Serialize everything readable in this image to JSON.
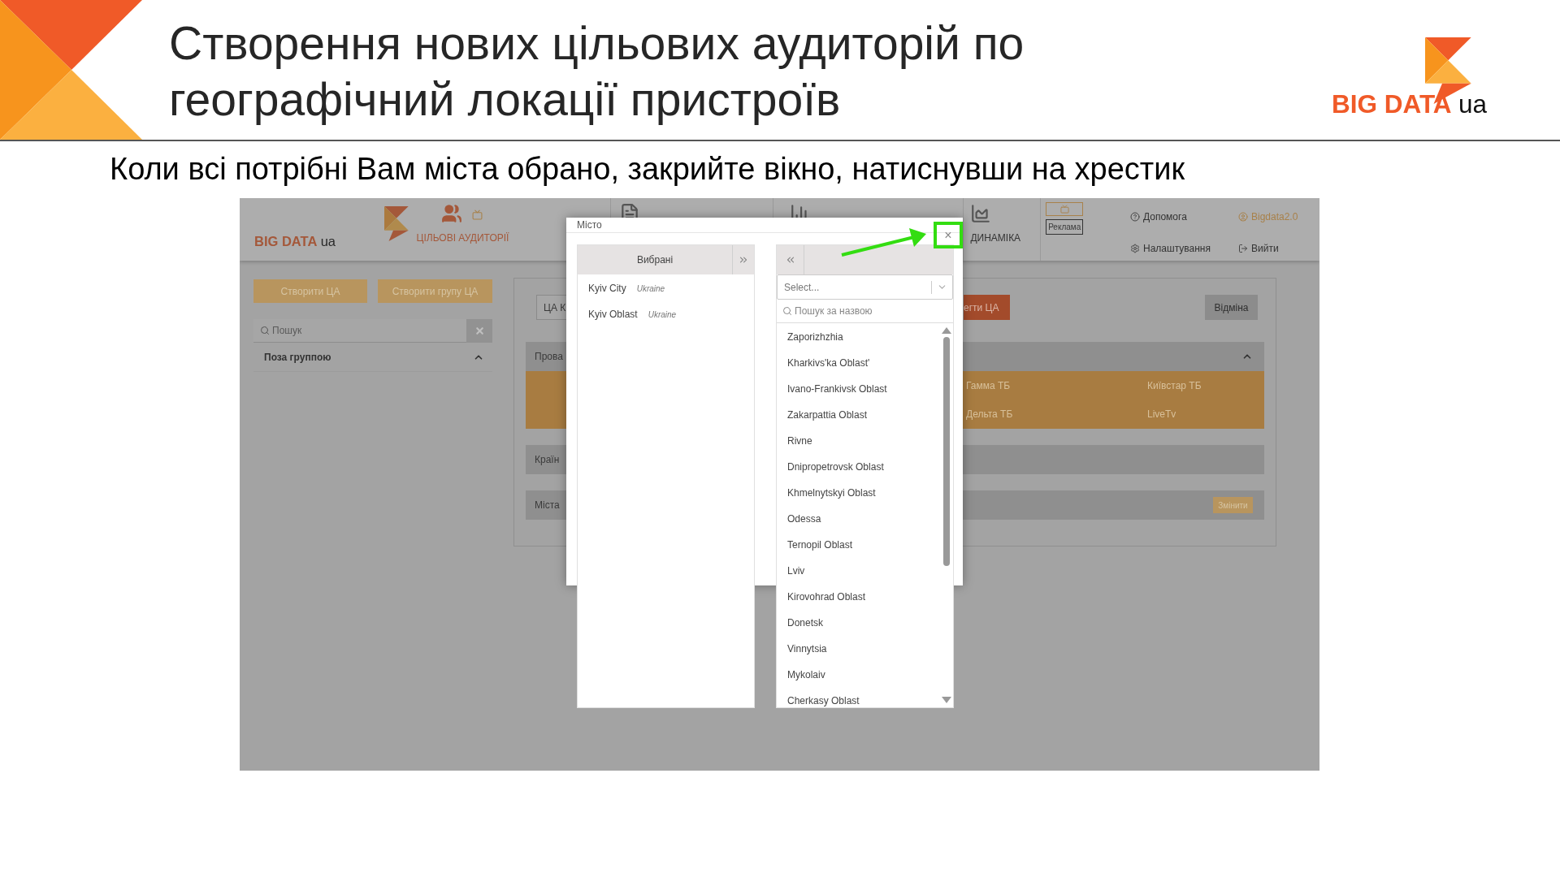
{
  "slide": {
    "title_lines": [
      "Створення нових цільових аудиторій по",
      "географічний локації пристроїв"
    ],
    "logo": {
      "text": "BIG DATA",
      "suffix": "ua"
    },
    "instruction": "Коли всі потрібні Вам міста обрано, закрийте вікно, натиснувши на хрестик"
  },
  "app": {
    "logo": {
      "text": "BIG DATA",
      "suffix": "ua"
    },
    "nav": [
      {
        "kind": "audiences",
        "label": "ЦІЛЬОВІ АУДИТОРІЇ"
      },
      {
        "kind": "documents"
      },
      {
        "kind": "reports"
      },
      {
        "kind": "dynamics",
        "label": "ДИНАМІКА"
      }
    ],
    "ad_badge": "Реклама",
    "links": [
      {
        "kind": "help",
        "label": "Допомога"
      },
      {
        "kind": "user",
        "label": "Bigdata2.0"
      },
      {
        "kind": "settings",
        "label": "Налаштування"
      },
      {
        "kind": "logout",
        "label": "Вийти"
      }
    ],
    "sidebar": {
      "buttons": [
        "Створити ЦА",
        "Створити групу ЦА"
      ],
      "search_placeholder": "Пошук",
      "group": {
        "label": "Поза группою",
        "expanded": true
      }
    },
    "editor": {
      "name_value": "ЦА К",
      "save_button": "егти ЦА",
      "cancel_button": "Відміна",
      "sections": [
        {
          "label": "Прова",
          "expanded": true,
          "items": [
            "Гамма ТБ",
            "Київстар ТБ",
            "Дельта ТБ",
            "LiveTv"
          ]
        },
        {
          "label": "Країн"
        },
        {
          "label": "Міста",
          "action": "Змінити"
        }
      ]
    }
  },
  "modal": {
    "title": "Місто",
    "close": "×",
    "selected_header": "Вибрані",
    "selected": [
      {
        "name": "Kyiv City",
        "country": "Ukraine"
      },
      {
        "name": "Kyiv Oblast",
        "country": "Ukraine"
      }
    ],
    "select_placeholder": "Select...",
    "search_placeholder": "Пошук за назвою",
    "options": [
      "Zaporizhzhia",
      "Kharkivs'ka Oblast'",
      "Ivano-Frankivsk Oblast",
      "Zakarpattia Oblast",
      "Rivne",
      "Dnipropetrovsk Oblast",
      "Khmelnytskyi Oblast",
      "Odessa",
      "Ternopil Oblast",
      "Lviv",
      "Kirovohrad Oblast",
      "Donetsk",
      "Vinnytsia",
      "Mykolaiv",
      "Cherkasy Oblast"
    ]
  }
}
